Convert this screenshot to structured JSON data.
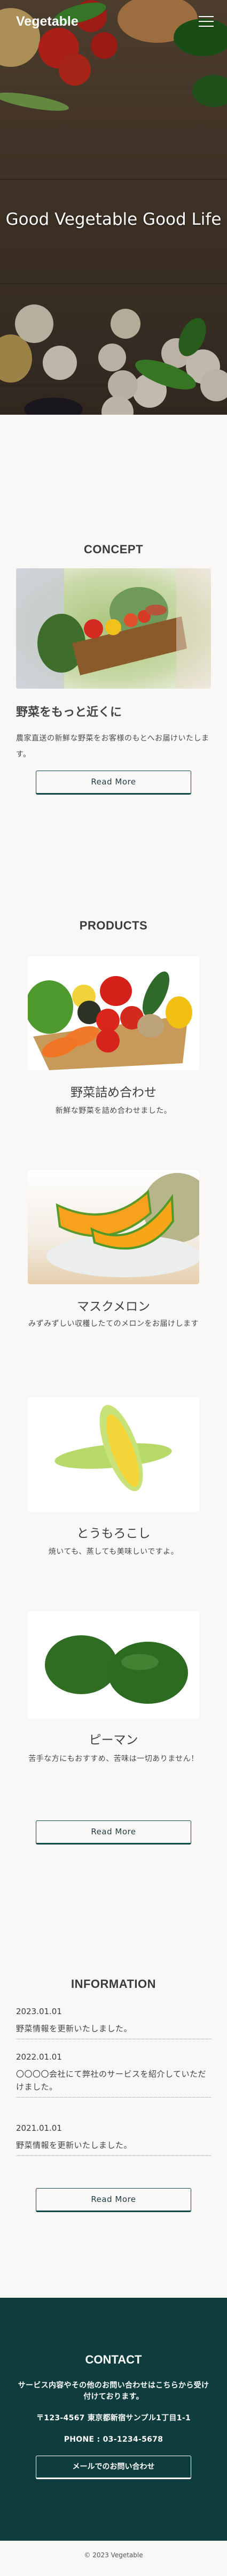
{
  "header": {
    "logo": "Vegetable",
    "menu_icon": "hamburger-icon"
  },
  "hero": {
    "title": "Good Vegetable Good Life"
  },
  "concept": {
    "heading": "CONCEPT",
    "subheading": "野菜をもっと近くに",
    "text": "農家直送の新鮮な野菜をお客様のもとへお届けいたします。",
    "button": "Read More"
  },
  "products": {
    "heading": "PRODUCTS",
    "items": [
      {
        "name": "野菜詰め合わせ",
        "desc": "新鮮な野菜を詰め合わせました。"
      },
      {
        "name": "マスクメロン",
        "desc": "みずみずしい収穫したてのメロンをお届けします"
      },
      {
        "name": "とうもろこし",
        "desc": "焼いても、蒸しても美味しいですよ。"
      },
      {
        "name": "ピーマン",
        "desc": "苦手な方にもおすすめ、苦味は一切ありません！"
      }
    ],
    "button": "Read More"
  },
  "information": {
    "heading": "INFORMATION",
    "items": [
      {
        "date": "2023.01.01",
        "text": "野菜情報を更新いたしました。"
      },
      {
        "date": "2022.01.01",
        "text": "〇〇〇〇会社にて弊社のサービスを紹介していただけました。"
      },
      {
        "date": "2021.01.01",
        "text": "野菜情報を更新いたしました。"
      }
    ],
    "button": "Read More"
  },
  "contact": {
    "heading": "CONTACT",
    "text": "サービス内容やその他のお問い合わせはこちらから受け付けております。",
    "address": "〒123-4567 東京都新宿サンプル1丁目1-1",
    "phone": "PHONE : 03-1234-5678",
    "button": "メールでのお問い合わせ"
  },
  "footer": {
    "copyright": "© 2023 Vegetable"
  },
  "colors": {
    "background": "#f9f8f6",
    "contact_bg": "#0f3c3c",
    "button_border": "#0f4a4a",
    "text": "#3f3f3f"
  }
}
